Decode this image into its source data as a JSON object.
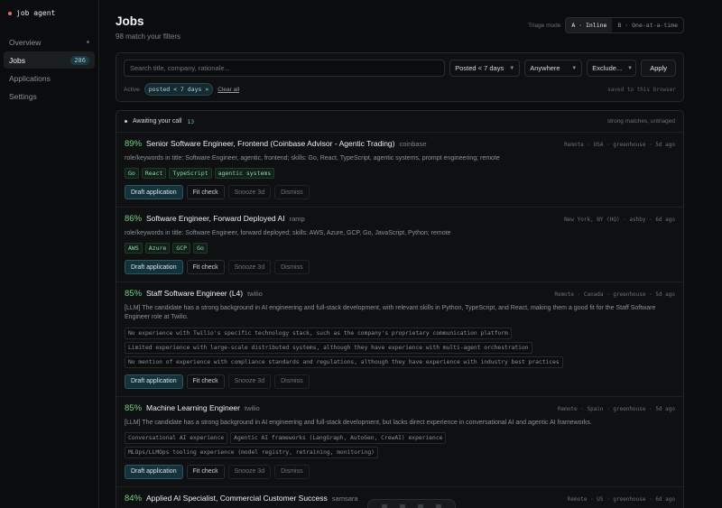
{
  "brand": {
    "name": "job agent"
  },
  "sidebar": {
    "items": [
      {
        "label": "Overview",
        "badge": ""
      },
      {
        "label": "Jobs",
        "badge": "286"
      },
      {
        "label": "Applications",
        "badge": ""
      },
      {
        "label": "Settings",
        "badge": ""
      }
    ]
  },
  "header": {
    "title": "Jobs",
    "subtitle": "98 match your filters",
    "triage_label": "Triage mode",
    "triage_options": [
      "A · Inline",
      "B · One-at-a-time"
    ]
  },
  "filters": {
    "search_placeholder": "Search title, company, rationale...",
    "posted": "Posted < 7 days",
    "location": "Anywhere",
    "exclude": "Exclude...",
    "apply_label": "Apply",
    "active_label": "Active",
    "active_chip": "posted < 7 days ×",
    "clear_label": "Clear all",
    "saved_note": "saved to this browser"
  },
  "list": {
    "heading": "Awaiting your call",
    "count": "13",
    "right_note": "strong matches, untriaged"
  },
  "actions": {
    "draft": "Draft application",
    "fit": "Fit check",
    "snooze": "Snooze 3d",
    "dismiss": "Dismiss"
  },
  "jobs": [
    {
      "score": "89%",
      "title": "Senior Software Engineer, Frontend (Coinbase Advisor - Agentic Trading)",
      "company": "coinbase",
      "meta": "Remote · USA · greenhouse · 5d ago",
      "rationale": "role/keywords in title: Software Engineer, agentic, frontend; skills: Go, React, TypeScript, agentic systems, prompt engineering; remote",
      "tags": [
        "Go",
        "React",
        "TypeScript",
        "agentic systems"
      ]
    },
    {
      "score": "86%",
      "title": "Software Engineer, Forward Deployed AI",
      "company": "ramp",
      "meta": "New York, NY (HQ) · ashby · 6d ago",
      "rationale": "role/keywords in title: Software Engineer, forward deployed; skills: AWS, Azure, GCP, Go, JavaScript, Python; remote",
      "tags": [
        "AWS",
        "Azure",
        "GCP",
        "Go"
      ]
    },
    {
      "score": "85%",
      "title": "Staff Software Engineer (L4)",
      "company": "twilio",
      "meta": "Remote · Canada · greenhouse · 5d ago",
      "rationale": "[LLM] The candidate has a strong background in AI engineering and full-stack development, with relevant skills in Python, TypeScript, and React, making them a good fit for the Staff Software Engineer role at Twilio.",
      "notes": [
        "No experience with Twilio's specific technology stack, such as the company's proprietary communication platform",
        "Limited experience with large-scale distributed systems, although they have experience with multi-agent orchestration",
        "No mention of experience with compliance standards and regulations, although they have experience with industry best practices"
      ]
    },
    {
      "score": "85%",
      "title": "Machine Learning Engineer",
      "company": "twilio",
      "meta": "Remote · Spain · greenhouse · 5d ago",
      "rationale": "[LLM] The candidate has a strong background in AI engineering and full-stack development, but lacks direct experience in conversational AI and agentic AI frameworks.",
      "notes": [
        "Conversational AI experience",
        "Agentic AI frameworks (LangGraph, AutoGen, CrewAI) experience",
        "MLOps/LLMOps tooling experience (model registry, retraining, monitoring)"
      ]
    },
    {
      "score": "84%",
      "title": "Applied AI Specialist, Commercial Customer Success",
      "company": "samsara",
      "meta": "Remote · US · greenhouse · 6d ago"
    }
  ]
}
